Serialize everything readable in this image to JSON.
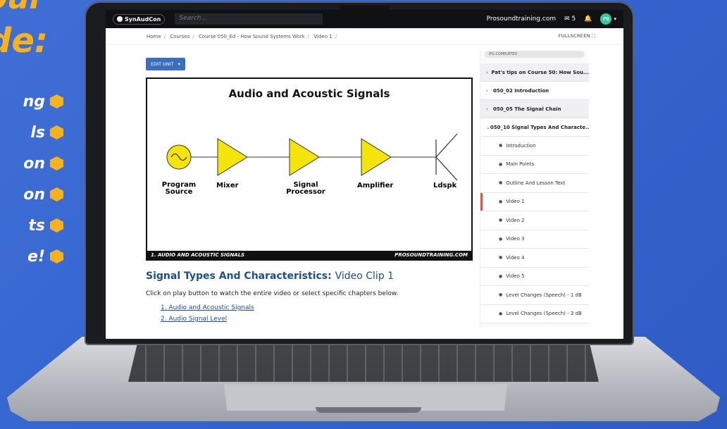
{
  "promo": {
    "line1": "our",
    "line2": "de:",
    "items": [
      "ng",
      "ls",
      "on",
      "on",
      "ts",
      "e!"
    ]
  },
  "topbar": {
    "logo": "SynAudCon",
    "search_placeholder": "Search...",
    "site": "Prosoundtraining.com",
    "count": "5",
    "avatar": "PB"
  },
  "breadcrumb": [
    "Home",
    "Courses",
    "Course 050_Ed - How Sound Systems Work",
    "Video 1"
  ],
  "fullscreen_label": "FULLSCREEN",
  "edit_unit_label": "EDIT UNIT",
  "video": {
    "title": "Audio and Acoustic Signals",
    "labels": [
      "Program Source",
      "Mixer",
      "Signal Processor",
      "Amplifier",
      "Ldspk"
    ],
    "footer_left": "1. AUDIO AND ACOUSTIC SIGNALS",
    "footer_right": "PROSOUNDTRAINING.COM"
  },
  "section": {
    "title": "Signal Types And Characteristics:",
    "subtitle": "Video Clip 1",
    "instructions": "Click on play button to watch the entire video or select specific chapters below.",
    "chapters": [
      "1. Audio and Acoustic Signals",
      "2. Audio Signal Level"
    ]
  },
  "sidebar": {
    "progress_label": "0% COMPLETED",
    "modules": [
      "Pat's tips on Course 50: How Sou...",
      "050_02 Introduction",
      "050_05 The Signal Chain",
      "050_10 Signal Types And Characte..."
    ],
    "lessons": [
      "Introduction",
      "Main Points",
      "Outline And Lesson Text",
      "Video 1",
      "Video 2",
      "Video 3",
      "Video 4",
      "Video 5",
      "Level Changes (Speech) - 1 dB",
      "Level Changes (Speech) - 3 dB"
    ],
    "active_lesson": "Video 1"
  },
  "colors": {
    "accent": "#f7b21c",
    "background": "#3565cf",
    "link": "#1a4fa3",
    "active_marker": "#e5533a"
  }
}
